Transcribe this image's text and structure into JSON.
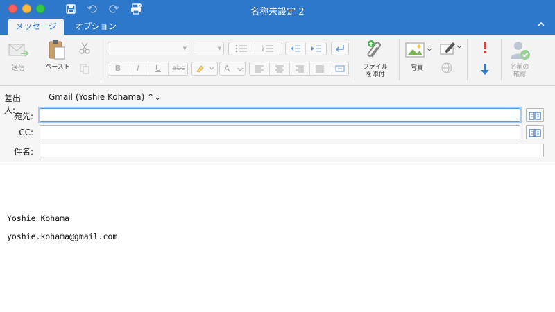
{
  "window": {
    "title": "名称未設定 2",
    "colors": {
      "titlebar": "#2e78cc",
      "ribbon_bg": "#f3f3f3",
      "focus_ring": "#5b9be3"
    }
  },
  "quick_access": [
    {
      "icon": "save-icon"
    },
    {
      "icon": "undo-icon"
    },
    {
      "icon": "redo-icon"
    },
    {
      "icon": "print-icon"
    }
  ],
  "tabs": [
    {
      "label": "メッセージ",
      "active": true
    },
    {
      "label": "オプション",
      "active": false
    }
  ],
  "ribbon": {
    "send_label": "送信",
    "paste_label": "ペースト",
    "attach_label_1": "ファイル",
    "attach_label_2": "を添付",
    "photo_label": "写真",
    "check_names_label_1": "名前の",
    "check_names_label_2": "確認",
    "format_buttons": {
      "bold": "B",
      "italic": "I",
      "underline": "U",
      "strike": "abc",
      "font_color": "A"
    }
  },
  "fields": {
    "from_label": "差出人:",
    "from_value": "Gmail (Yoshie Kohama) ⌃⌄",
    "to_label": "宛先:",
    "to_value": "",
    "cc_label": "CC:",
    "cc_value": "",
    "subject_label": "件名:",
    "subject_value": ""
  },
  "body": {
    "signature_name": "Yoshie Kohama",
    "signature_email": "yoshie.kohama@gmail.com"
  }
}
